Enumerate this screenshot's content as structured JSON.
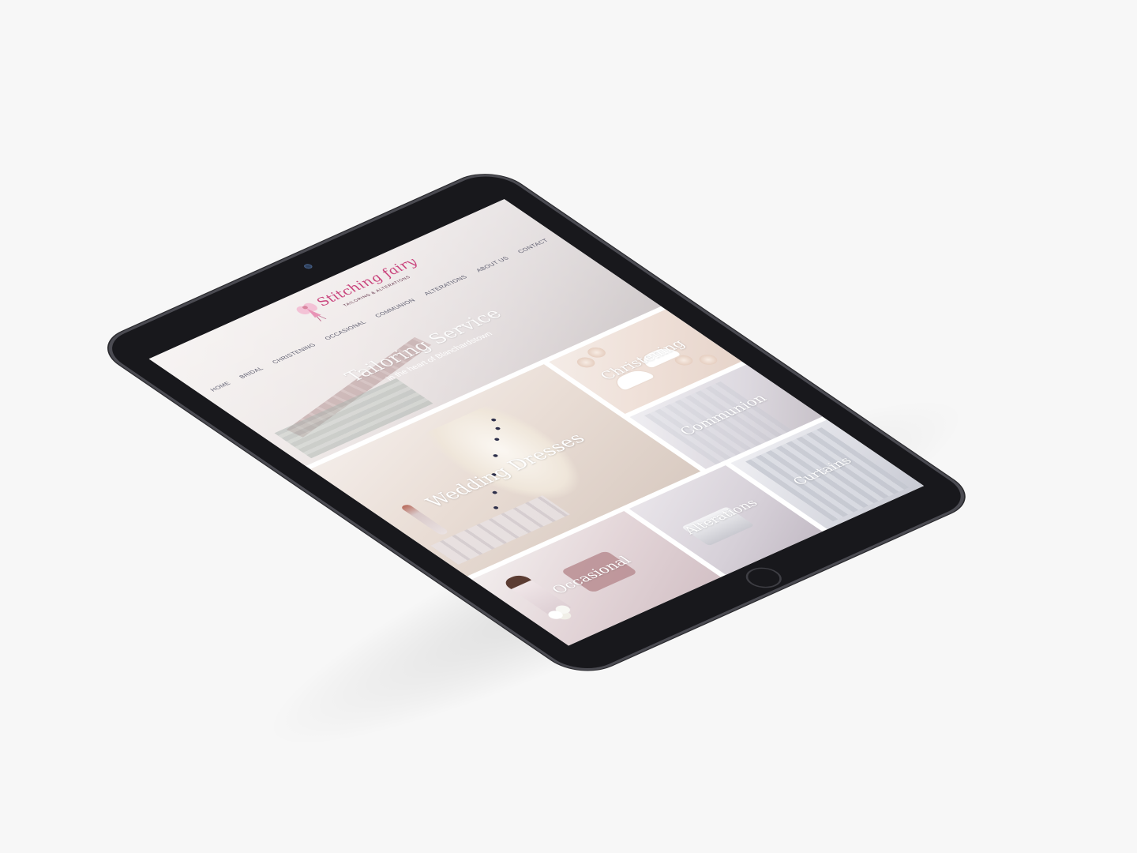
{
  "site": {
    "logo_script": "Stitching fairy",
    "logo_tagline": "TAILORING & ALTERATIONS"
  },
  "nav": {
    "items": [
      "HOME",
      "BRIDAL",
      "CHRISTENING",
      "OCCASIONAL",
      "COMMUNION",
      "ALTERATIONS",
      "ABOUT US",
      "CONTACT"
    ]
  },
  "hero": {
    "title": "Tailoring Service",
    "subtitle": "in the heart of Blanchardstown"
  },
  "tiles": {
    "wedding": "Wedding Dresses",
    "christening": "Christening",
    "communion": "Communion",
    "occasional": "Occasional",
    "alterations": "Alterations",
    "curtains": "Curtains"
  },
  "colors": {
    "brand_pink": "#c9437c",
    "nav_text": "#5c5c6e",
    "device_frame": "#18181c"
  }
}
